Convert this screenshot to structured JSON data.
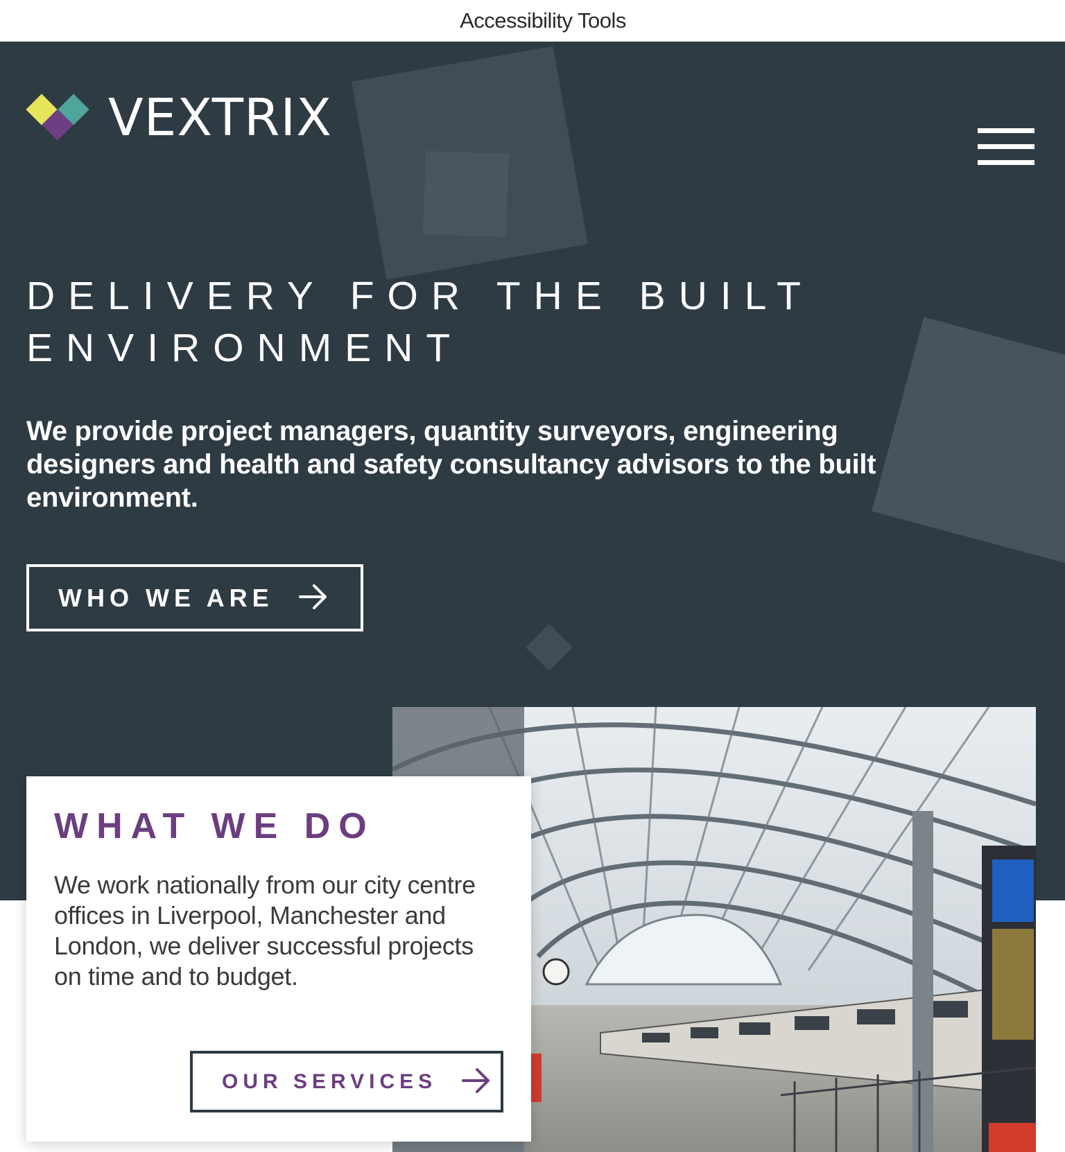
{
  "topbar": {
    "accessibility_label": "Accessibility Tools"
  },
  "header": {
    "brand_name": "VEXTRIX",
    "logo_colors": {
      "yellow": "#e6e55a",
      "teal": "#4fa59a",
      "purple": "#6e3e84"
    },
    "menu_icon": "hamburger-icon"
  },
  "hero": {
    "headline_line1": "DELIVERY FOR THE BUILT",
    "headline_line2": "ENVIRONMENT",
    "lead": "We provide project managers, quantity surveyors, engineering designers and health and safety consultancy advisors to the built environment.",
    "cta_label": "WHO WE ARE",
    "cta_icon": "arrow-right-icon",
    "background_color": "#2f3b43"
  },
  "what_we_do": {
    "title": "WHAT WE DO",
    "text": "We work nationally from our city centre offices in Liverpool, Manchester and London, we deliver successful projects on time and to budget.",
    "cta_label": "OUR SERVICES",
    "cta_icon": "arrow-right-icon",
    "accent_color": "#6b3e80"
  },
  "image": {
    "subject": "railway-station-photo"
  }
}
